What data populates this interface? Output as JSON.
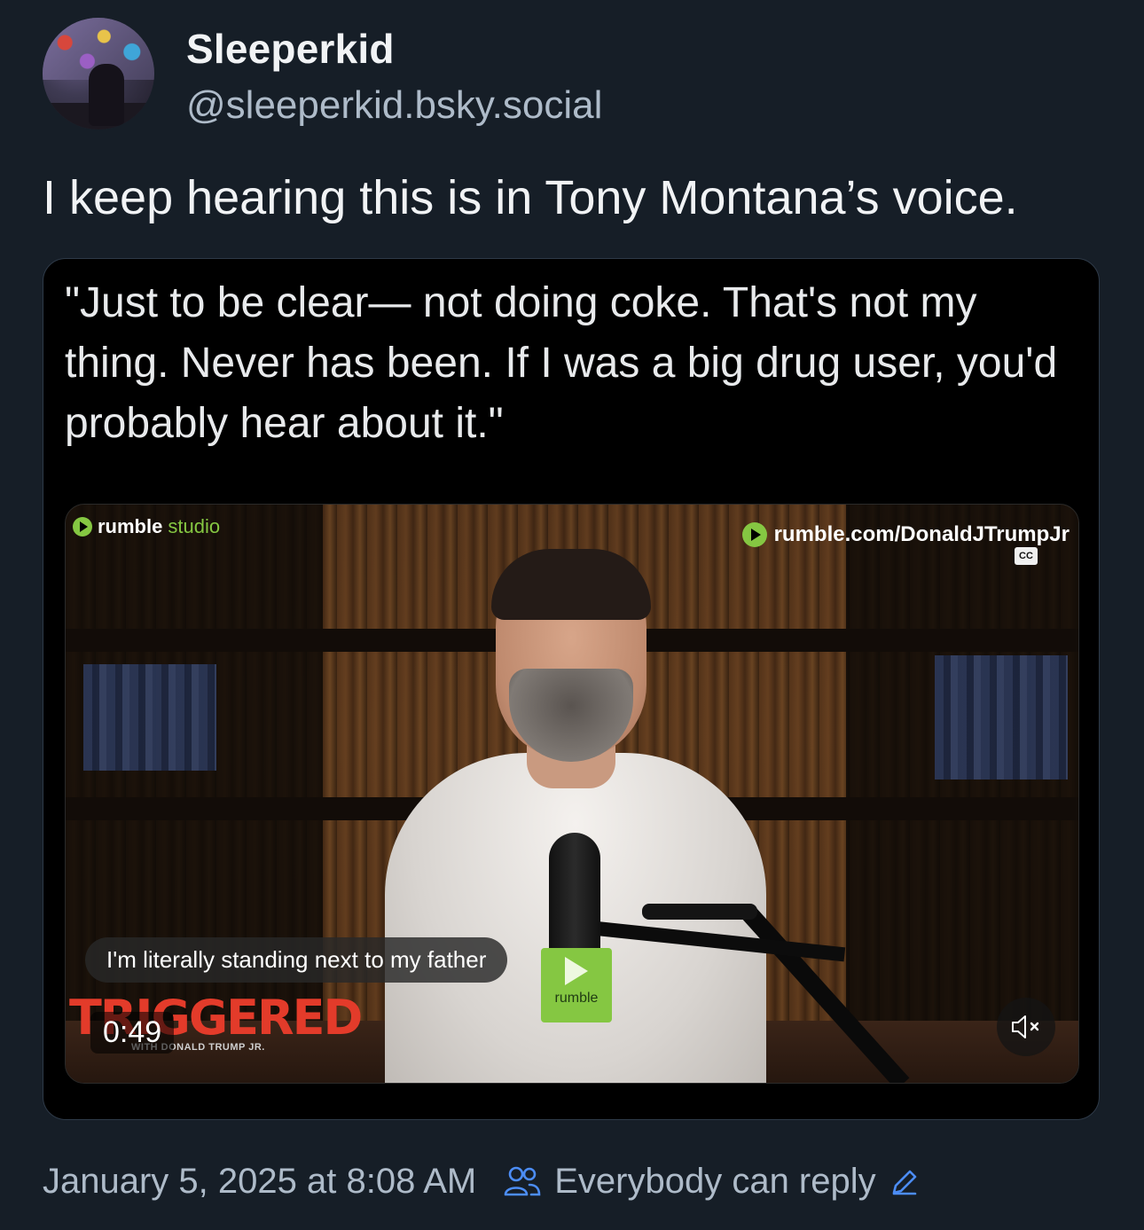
{
  "author": {
    "display_name": "Sleeperkid",
    "handle": "@sleeperkid.bsky.social"
  },
  "post": {
    "text": "I keep hearing this is in Tony Montana’s voice."
  },
  "embed": {
    "quote": "\"Just to be clear— not doing coke. That's not my thing. Never has been. If I was a big drug user, you'd probably hear about it.\"",
    "video": {
      "watermark_left_brand": "rumble",
      "watermark_left_suffix": "studio",
      "watermark_right": "rumble.com/DonaldJTrumpJr",
      "cc_label": "CC",
      "show_title": "TRIGGERED",
      "show_subtitle": "WITH DONALD TRUMP JR.",
      "mic_flag": "rumble",
      "caption": "I'm literally standing next to my father",
      "timestamp": "0:49",
      "muted": true,
      "icons": [
        "play-icon",
        "mute-icon"
      ]
    }
  },
  "footer": {
    "date": "January 5, 2025 at 8:08 AM",
    "reply_setting": "Everybody can reply",
    "icons": [
      "people-icon",
      "edit-pencil-icon"
    ]
  },
  "colors": {
    "background": "#161e27",
    "text_primary": "#f1f3f5",
    "text_secondary": "#aebbc9",
    "accent_link": "#4c8df6",
    "rumble_green": "#85c742",
    "triggered_red": "#e33b2a"
  }
}
